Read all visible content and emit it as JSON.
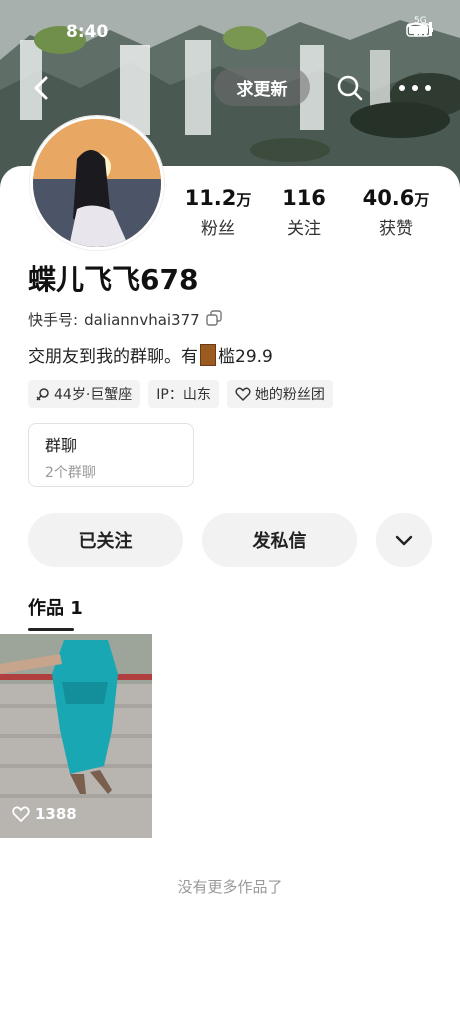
{
  "status": {
    "time": "8:40",
    "network": "5G"
  },
  "nav": {
    "title": "求更新"
  },
  "profile": {
    "stats": [
      {
        "value": "11.2",
        "unit": "万",
        "label": "粉丝"
      },
      {
        "value": "116",
        "unit": "",
        "label": "关注"
      },
      {
        "value": "40.6",
        "unit": "万",
        "label": "获赞"
      }
    ],
    "nickname": "蝶儿飞飞678",
    "id_label": "快手号:",
    "id_value": "daliannvhai377",
    "bio_prefix": "交朋友到我的群聊。有",
    "bio_suffix": "槛29.9",
    "tags": [
      {
        "icon": "gender-icon",
        "text": "44岁·巨蟹座"
      },
      {
        "icon": "",
        "text": "IP：山东"
      },
      {
        "icon": "heart-outline-icon",
        "text": "她的粉丝团"
      }
    ],
    "group": {
      "title": "群聊",
      "subtitle": "2个群聊"
    }
  },
  "actions": {
    "follow": "已关注",
    "message": "发私信"
  },
  "works": {
    "tab_label": "作品 1",
    "items": [
      {
        "likes": "1388"
      }
    ]
  },
  "footer": {
    "no_more": "没有更多作品了"
  }
}
